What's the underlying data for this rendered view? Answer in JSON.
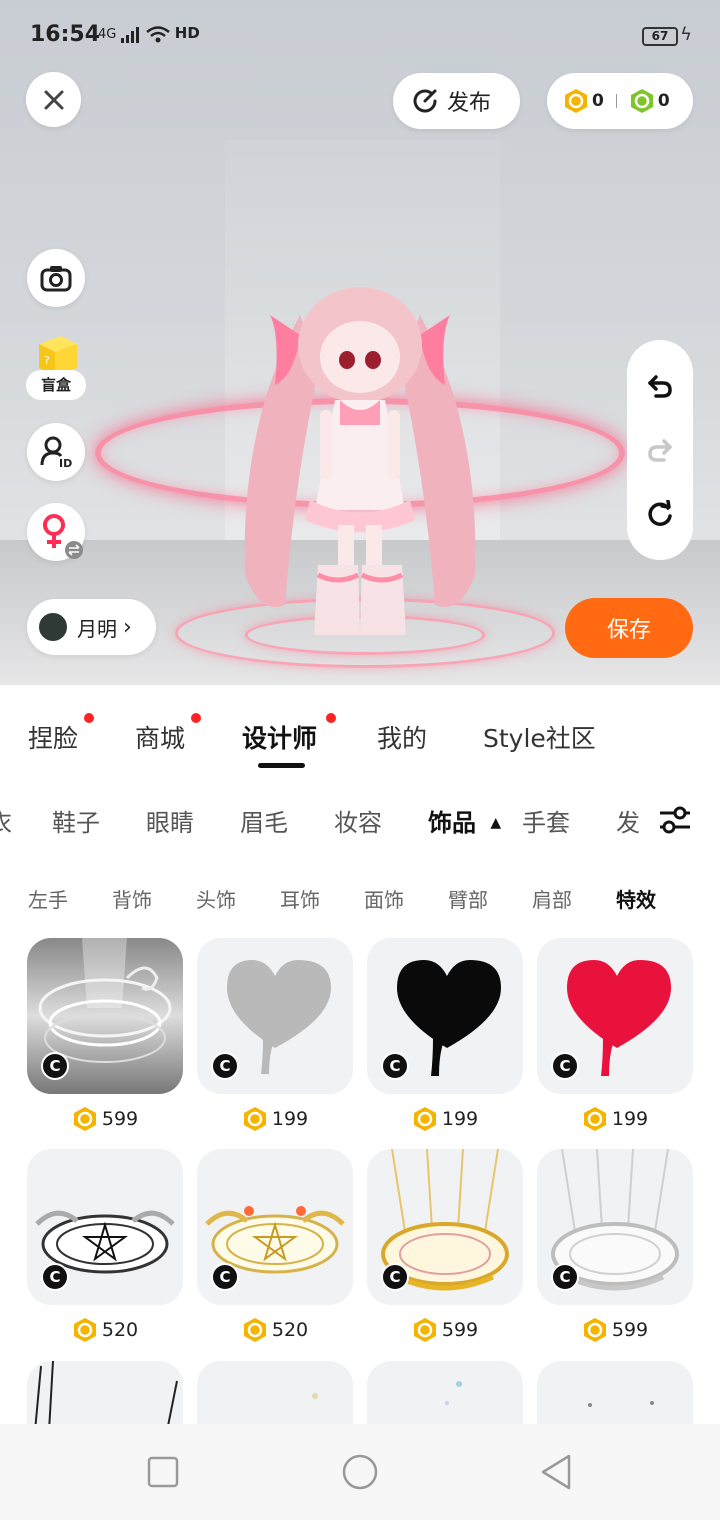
{
  "status_bar": {
    "time": "16:54",
    "network": "4G",
    "hd": "HD",
    "battery": "67"
  },
  "top_bar": {
    "publish_label": "发布",
    "coins_gold": "0",
    "coins_green": "0"
  },
  "side": {
    "blindbox_label": "盲盒"
  },
  "user": {
    "name": "月明"
  },
  "save_label": "保存",
  "main_tabs": [
    {
      "label": "捏脸",
      "dot": true
    },
    {
      "label": "商城",
      "dot": true
    },
    {
      "label": "设计师",
      "dot": true
    },
    {
      "label": "我的",
      "dot": false
    },
    {
      "label": "Style社区",
      "dot": false
    }
  ],
  "sub_tabs": [
    "衣",
    "鞋子",
    "眼睛",
    "眉毛",
    "妆容",
    "饰品",
    "手套",
    "发"
  ],
  "cat_tabs": [
    "左手",
    "背饰",
    "头饰",
    "耳饰",
    "面饰",
    "臂部",
    "肩部",
    "特效"
  ],
  "items": [
    {
      "price": "599",
      "art": "silver-rings"
    },
    {
      "price": "199",
      "art": "heart-grey"
    },
    {
      "price": "199",
      "art": "heart-black"
    },
    {
      "price": "199",
      "art": "heart-red"
    },
    {
      "price": "520",
      "art": "pentagram-silver"
    },
    {
      "price": "520",
      "art": "pentagram-gold"
    },
    {
      "price": "599",
      "art": "magic-circle-gold"
    },
    {
      "price": "599",
      "art": "magic-circle-silver"
    }
  ],
  "colors": {
    "accent": "#ff6a13",
    "coin_gold": "#f5b400",
    "coin_green": "#7dc62a",
    "heart_red": "#e8123c"
  }
}
